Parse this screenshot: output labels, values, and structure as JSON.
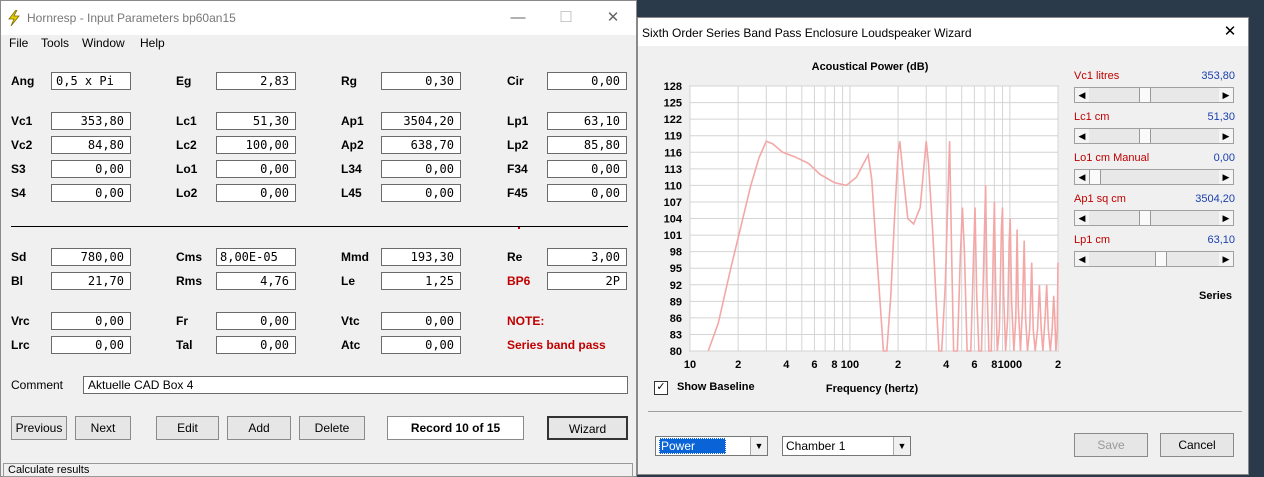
{
  "window1": {
    "title": "Hornresp - Input Parameters   bp60an15",
    "menu": [
      "File",
      "Tools",
      "Window",
      "Help"
    ],
    "params": {
      "ang": {
        "label": "Ang",
        "value": "0,5 x Pi"
      },
      "eg": {
        "label": "Eg",
        "value": "2,83"
      },
      "rg": {
        "label": "Rg",
        "value": "0,30"
      },
      "cir": {
        "label": "Cir",
        "value": "0,00"
      },
      "vc1": {
        "label": "Vc1",
        "value": "353,80"
      },
      "lc1": {
        "label": "Lc1",
        "value": "51,30"
      },
      "ap1": {
        "label": "Ap1",
        "value": "3504,20"
      },
      "lp1": {
        "label": "Lp1",
        "value": "63,10"
      },
      "vc2": {
        "label": "Vc2",
        "value": "84,80"
      },
      "lc2": {
        "label": "Lc2",
        "value": "100,00"
      },
      "ap2": {
        "label": "Ap2",
        "value": "638,70"
      },
      "lp2": {
        "label": "Lp2",
        "value": "85,80"
      },
      "s3": {
        "label": "S3",
        "value": "0,00"
      },
      "lo1": {
        "label": "Lo1",
        "value": "0,00"
      },
      "l34": {
        "label": "L34",
        "value": "0,00"
      },
      "f34": {
        "label": "F34",
        "value": "0,00"
      },
      "s4": {
        "label": "S4",
        "value": "0,00"
      },
      "lo2": {
        "label": "Lo2",
        "value": "0,00"
      },
      "l45": {
        "label": "L45",
        "value": "0,00"
      },
      "f45": {
        "label": "F45",
        "value": "0,00"
      },
      "sd": {
        "label": "Sd",
        "value": "780,00"
      },
      "cms": {
        "label": "Cms",
        "value": "8,00E-05"
      },
      "mmd": {
        "label": "Mmd",
        "value": "193,30"
      },
      "re": {
        "label": "Re",
        "value": "3,00"
      },
      "bl": {
        "label": "Bl",
        "value": "21,70"
      },
      "rms": {
        "label": "Rms",
        "value": "4,76"
      },
      "le": {
        "label": "Le",
        "value": "1,25"
      },
      "bp6": {
        "label": "BP6",
        "value": "2P"
      },
      "vrc": {
        "label": "Vrc",
        "value": "0,00"
      },
      "fr": {
        "label": "Fr",
        "value": "0,00"
      },
      "vtc": {
        "label": "Vtc",
        "value": "0,00"
      },
      "lrc": {
        "label": "Lrc",
        "value": "0,00"
      },
      "tal": {
        "label": "Tal",
        "value": "0,00"
      },
      "atc": {
        "label": "Atc",
        "value": "0,00"
      }
    },
    "note_label": "NOTE:",
    "note_text": "Series band pass",
    "comment_label": "Comment",
    "comment_value": "Aktuelle CAD Box 4",
    "buttons": {
      "previous": "Previous",
      "next": "Next",
      "edit": "Edit",
      "add": "Add",
      "delete": "Delete",
      "wizard": "Wizard"
    },
    "record": "Record 10 of 15",
    "status": "Calculate results"
  },
  "window2": {
    "title": "Sixth Order Series Band Pass Enclosure Loudspeaker Wizard",
    "sliders": [
      {
        "label": "Vc1  litres",
        "value": "353,80",
        "pos": 0.42
      },
      {
        "label": "Lc1  cm",
        "value": "51,30",
        "pos": 0.42
      },
      {
        "label": "Lo1  cm  Manual",
        "value": "0,00",
        "pos": 0.0
      },
      {
        "label": "Ap1  sq cm",
        "value": "3504,20",
        "pos": 0.42
      },
      {
        "label": "Lp1  cm",
        "value": "63,10",
        "pos": 0.55
      }
    ],
    "series_label": "Series",
    "show_baseline": "Show Baseline",
    "dropdown_mode": "Power",
    "dropdown_chamber": "Chamber 1",
    "save": "Save",
    "cancel": "Cancel"
  },
  "colors": {
    "curve": "#f4a7a7",
    "note": "#c00000",
    "slider_value": "#1a3fae",
    "selection": "#0a64d8"
  },
  "chart_data": {
    "type": "line",
    "title": "Acoustical Power (dB)",
    "xlabel": "Frequency (hertz)",
    "ylabel": "",
    "xscale": "log",
    "xlim": [
      10,
      2000
    ],
    "ylim": [
      80,
      128
    ],
    "y_ticks": [
      128,
      125,
      122,
      119,
      116,
      113,
      110,
      107,
      104,
      101,
      98,
      95,
      92,
      89,
      86,
      83,
      80
    ],
    "x_ticks": [
      {
        "value": 10,
        "label": "10"
      },
      {
        "value": 20,
        "label": "2"
      },
      {
        "value": 40,
        "label": "4"
      },
      {
        "value": 60,
        "label": "6"
      },
      {
        "value": 80,
        "label": "8"
      },
      {
        "value": 100,
        "label": "100"
      },
      {
        "value": 200,
        "label": "2"
      },
      {
        "value": 400,
        "label": "4"
      },
      {
        "value": 600,
        "label": "6"
      },
      {
        "value": 800,
        "label": "8"
      },
      {
        "value": 1000,
        "label": "1000"
      },
      {
        "value": 2000,
        "label": "2"
      }
    ],
    "grid": true,
    "series": [
      {
        "values": [
          [
            13,
            80
          ],
          [
            15,
            85
          ],
          [
            18,
            95
          ],
          [
            21,
            103
          ],
          [
            24,
            110
          ],
          [
            27,
            115
          ],
          [
            30,
            118
          ],
          [
            33,
            117.5
          ],
          [
            38,
            116
          ],
          [
            45,
            115.2
          ],
          [
            55,
            114
          ],
          [
            65,
            112
          ],
          [
            80,
            110.5
          ],
          [
            95,
            110
          ],
          [
            110,
            111.5
          ],
          [
            122,
            114
          ],
          [
            130,
            115.5
          ],
          [
            137,
            111
          ],
          [
            145,
            100
          ],
          [
            155,
            88
          ],
          [
            162,
            80
          ],
          [
            170,
            80
          ],
          [
            180,
            90
          ],
          [
            190,
            104
          ],
          [
            200,
            116
          ],
          [
            205,
            118
          ],
          [
            215,
            112
          ],
          [
            230,
            104
          ],
          [
            250,
            103
          ],
          [
            275,
            106
          ],
          [
            300,
            118
          ],
          [
            310,
            114
          ],
          [
            330,
            101
          ],
          [
            345,
            90
          ],
          [
            360,
            80
          ],
          [
            375,
            80
          ],
          [
            395,
            92
          ],
          [
            420,
            118
          ],
          [
            432,
            98
          ],
          [
            445,
            80
          ],
          [
            470,
            80
          ],
          [
            490,
            97
          ],
          [
            505,
            106
          ],
          [
            520,
            98
          ],
          [
            540,
            80
          ],
          [
            570,
            80
          ],
          [
            590,
            95
          ],
          [
            605,
            106
          ],
          [
            620,
            90
          ],
          [
            640,
            80
          ],
          [
            665,
            80
          ],
          [
            690,
            99
          ],
          [
            705,
            110
          ],
          [
            720,
            92
          ],
          [
            740,
            80
          ],
          [
            765,
            80
          ],
          [
            790,
            100
          ],
          [
            800,
            107
          ],
          [
            815,
            92
          ],
          [
            835,
            80
          ],
          [
            860,
            84
          ],
          [
            885,
            102
          ],
          [
            900,
            106
          ],
          [
            915,
            90
          ],
          [
            940,
            80
          ],
          [
            970,
            86
          ],
          [
            990,
            100
          ],
          [
            1005,
            104
          ],
          [
            1025,
            89
          ],
          [
            1060,
            80
          ],
          [
            1090,
            86
          ],
          [
            1110,
            102
          ],
          [
            1130,
            88
          ],
          [
            1165,
            80
          ],
          [
            1200,
            88
          ],
          [
            1230,
            100
          ],
          [
            1255,
            86
          ],
          [
            1290,
            80
          ],
          [
            1330,
            84
          ],
          [
            1370,
            96
          ],
          [
            1400,
            84
          ],
          [
            1440,
            80
          ],
          [
            1490,
            84
          ],
          [
            1530,
            92
          ],
          [
            1570,
            84
          ],
          [
            1610,
            80
          ],
          [
            1660,
            86
          ],
          [
            1700,
            92
          ],
          [
            1740,
            84
          ],
          [
            1790,
            80
          ],
          [
            1840,
            84
          ],
          [
            1880,
            90
          ],
          [
            1910,
            86
          ],
          [
            1940,
            80
          ],
          [
            1980,
            84
          ],
          [
            2000,
            96
          ]
        ]
      }
    ]
  }
}
